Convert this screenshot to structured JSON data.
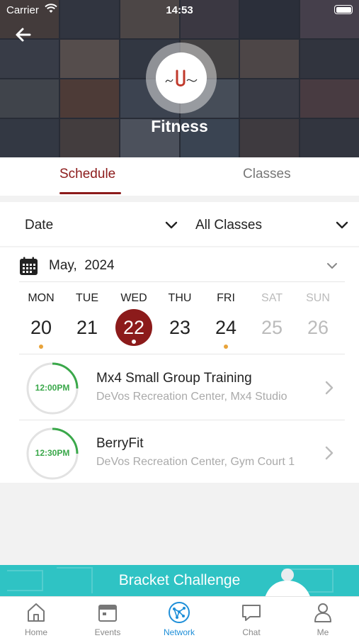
{
  "status_bar": {
    "carrier": "Carrier",
    "time": "14:53"
  },
  "header": {
    "title": "Fitness"
  },
  "tabs": [
    {
      "label": "Schedule",
      "active": true
    },
    {
      "label": "Classes",
      "active": false
    }
  ],
  "filters": {
    "date_label": "Date",
    "class_filter": "All Classes"
  },
  "calendar": {
    "month_label": "May,  2024",
    "days": [
      {
        "dow": "MON",
        "num": "20",
        "dot": true,
        "muted": false,
        "selected": false
      },
      {
        "dow": "TUE",
        "num": "21",
        "dot": false,
        "muted": false,
        "selected": false
      },
      {
        "dow": "WED",
        "num": "22",
        "dot": true,
        "muted": false,
        "selected": true
      },
      {
        "dow": "THU",
        "num": "23",
        "dot": false,
        "muted": false,
        "selected": false
      },
      {
        "dow": "FRI",
        "num": "24",
        "dot": true,
        "muted": false,
        "selected": false
      },
      {
        "dow": "SAT",
        "num": "25",
        "dot": false,
        "muted": true,
        "selected": false
      },
      {
        "dow": "SUN",
        "num": "26",
        "dot": false,
        "muted": true,
        "selected": false
      }
    ]
  },
  "classes": [
    {
      "time": "12:00PM",
      "name": "Mx4 Small Group Training",
      "location": "DeVos Recreation Center, Mx4 Studio"
    },
    {
      "time": "12:30PM",
      "name": "BerryFit",
      "location": "DeVos Recreation Center, Gym Court 1"
    }
  ],
  "banner": {
    "text": "Bracket Challenge"
  },
  "bottom_nav": [
    {
      "label": "Home",
      "icon": "home-icon",
      "active": false
    },
    {
      "label": "Events",
      "icon": "calendar-icon",
      "active": false
    },
    {
      "label": "Network",
      "icon": "network-icon",
      "active": true
    },
    {
      "label": "Chat",
      "icon": "chat-icon",
      "active": false
    },
    {
      "label": "Me",
      "icon": "person-icon",
      "active": false
    }
  ],
  "colors": {
    "accent": "#8c1b1b",
    "time_ring": "#3aa84a",
    "event_dot": "#e8a33a",
    "banner": "#2fc3c4",
    "nav_active": "#1f8fd8"
  }
}
